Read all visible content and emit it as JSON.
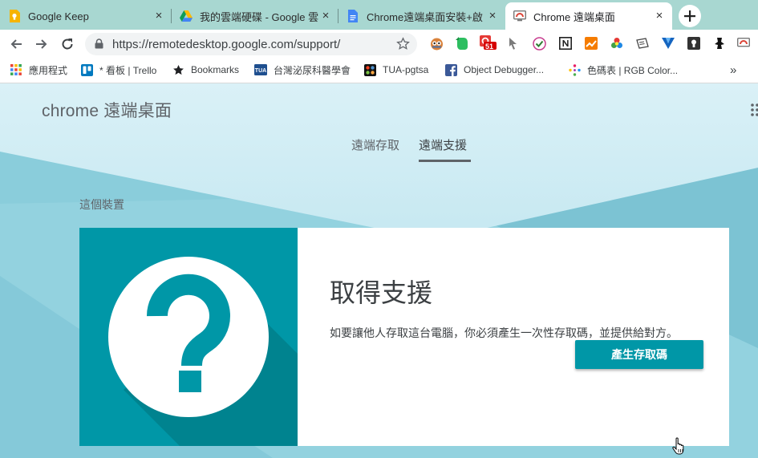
{
  "tabs": [
    {
      "title": "Google Keep",
      "icon": "keep-icon"
    },
    {
      "title": "我的雲端硬碟 - Google 雲",
      "icon": "drive-icon"
    },
    {
      "title": "Chrome遠端桌面安裝+啟",
      "icon": "docs-icon"
    },
    {
      "title": "Chrome 遠端桌面",
      "icon": "remote-desktop-icon",
      "active": true
    }
  ],
  "tab_close": "×",
  "toolbar": {
    "url": "https://remotedesktop.google.com/support/",
    "ext_badge": "51"
  },
  "bookmarks": [
    {
      "label": "應用程式",
      "icon": "apps-grid-icon"
    },
    {
      "label": "* 看板 | Trello",
      "icon": "trello-icon"
    },
    {
      "label": "Bookmarks",
      "icon": "star-icon"
    },
    {
      "label": "台灣泌尿科醫學會",
      "icon": "tua-icon"
    },
    {
      "label": "TUA-pgtsa",
      "icon": "joomla-icon"
    },
    {
      "label": "Object Debugger...",
      "icon": "facebook-icon"
    },
    {
      "label": "色碼表 | RGB Color...",
      "icon": "color-dots-icon"
    }
  ],
  "bookmarks_overflow": "»",
  "page": {
    "brand": "chrome 遠端桌面",
    "nav": [
      {
        "label": "遠端存取",
        "active": false
      },
      {
        "label": "遠端支援",
        "active": true
      }
    ],
    "section_label": "這個裝置",
    "card": {
      "title": "取得支援",
      "description": "如要讓他人存取這台電腦，你必須產生一次性存取碼，並提供給對方。",
      "button": "產生存取碼"
    }
  },
  "colors": {
    "tabstrip": "#a8d7d1",
    "accent": "#0097a7",
    "page_bg": "#7cc4d5"
  }
}
